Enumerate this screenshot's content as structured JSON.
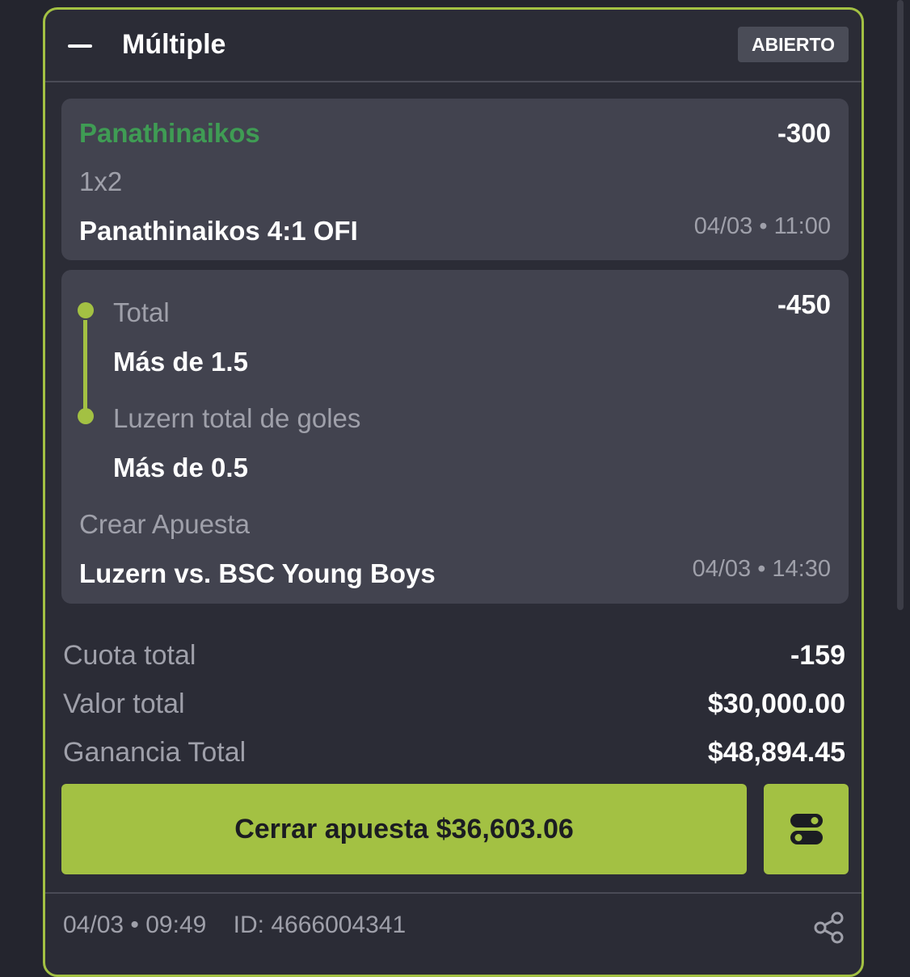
{
  "header": {
    "title": "Múltiple",
    "status": "ABIERTO"
  },
  "legs": [
    {
      "team": "Panathinaikos",
      "odds": "-300",
      "market": "1x2",
      "match": "Panathinaikos 4:1 OFI",
      "datetime": "04/03 • 11:00"
    },
    {
      "odds": "-450",
      "selections": [
        {
          "market": "Total",
          "pick": "Más de 1.5"
        },
        {
          "market": "Luzern total de goles",
          "pick": "Más de 0.5"
        }
      ],
      "bet_type": "Crear Apuesta",
      "match": "Luzern vs. BSC Young Boys",
      "datetime": "04/03 • 14:30"
    }
  ],
  "summary": {
    "total_odds_label": "Cuota total",
    "total_odds": "-159",
    "stake_label": "Valor total",
    "stake": "$30,000.00",
    "payout_label": "Ganancia Total",
    "payout": "$48,894.45"
  },
  "actions": {
    "cashout_label": "Cerrar apuesta $36,603.06"
  },
  "footer": {
    "meta": "04/03 • 09:49    ID: 4666004341"
  },
  "colors": {
    "accent": "#a3c143",
    "winning_team": "#3f9c54",
    "background": "#24252e",
    "card": "#2b2c36",
    "leg_panel": "#42434f"
  },
  "icons": {
    "collapse": "minus-icon",
    "settings_toggle": "toggle-icon",
    "share": "share-icon"
  }
}
